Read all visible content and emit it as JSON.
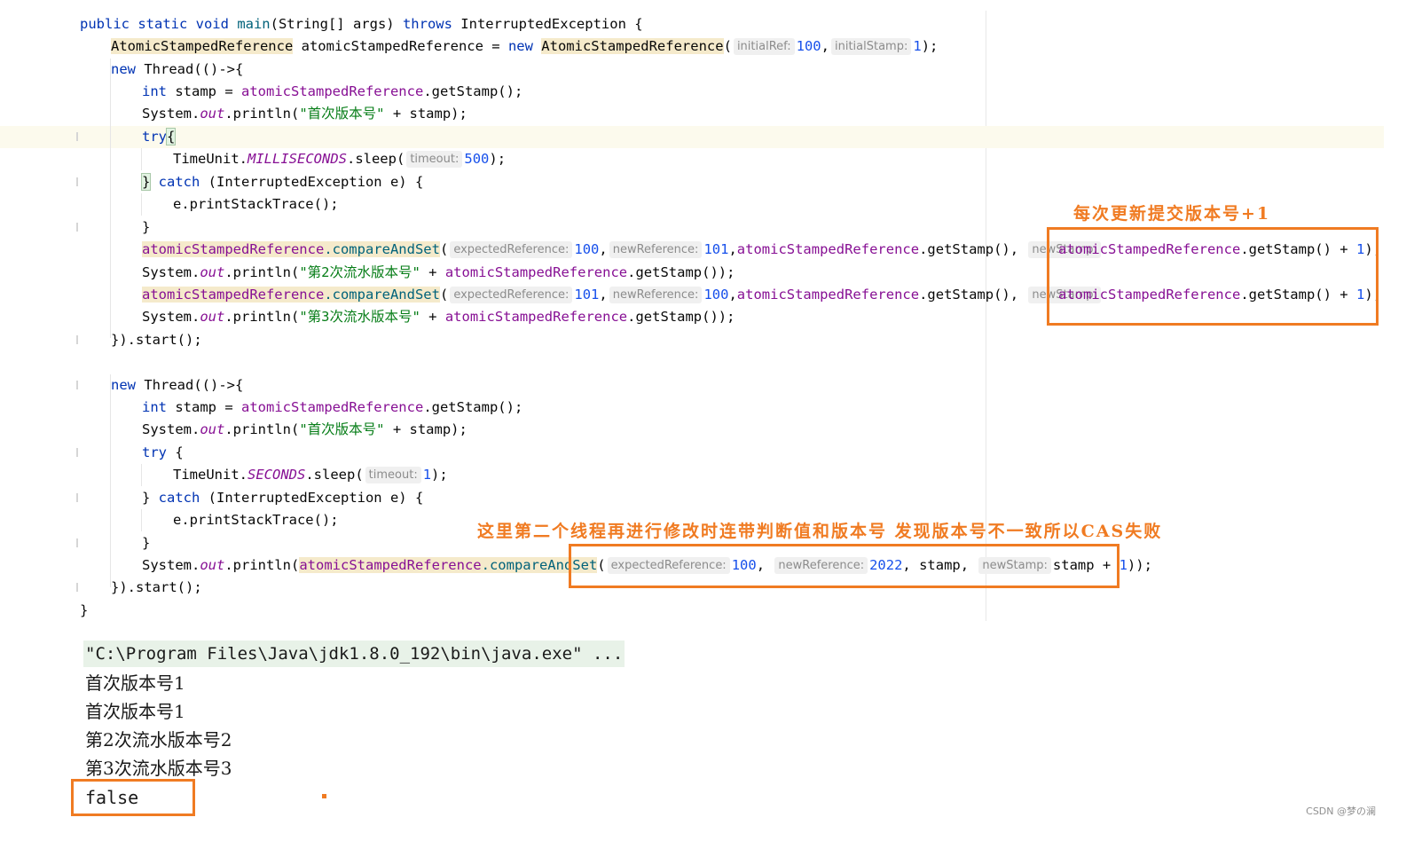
{
  "editor": {
    "lines": [
      {
        "t1": "public static void main(String[] args) throws InterruptedException {"
      },
      {
        "cls": "AtomicStampedReference",
        "var": " atomicStampedReference = ",
        "new": "new ",
        "ctor": "AtomicStampedReference",
        "open": "(",
        "hint1": "initialRef:",
        "v1": "100",
        "sep": ",",
        "hint2": "initialStamp:",
        "v2": "1",
        "close": ");"
      },
      {
        "kw": "new",
        "rest": " Thread(()->{"
      },
      {
        "kw": "int",
        "rest": " stamp = ",
        "fld": "atomicStampedReference",
        "tail": ".getStamp();"
      },
      {
        "a": "System.",
        "b": "out",
        "c": ".println(",
        "s": "\"首次版本号\"",
        "d": " + stamp);"
      },
      {
        "kw": "try",
        "rest": " {"
      },
      {
        "a": "TimeUnit.",
        "b": "MILLISECONDS",
        "c": ".sleep(",
        "hint": "timeout:",
        "v": "500",
        "d": ");"
      },
      {
        "b1": "}",
        "kw": " catch",
        "rest": " (InterruptedException e) {"
      },
      {
        "a": "e.printStackTrace();"
      },
      {
        "a": "}"
      },
      {
        "fld": "atomicStampedReference",
        "m": ".compareAndSet",
        "open": "(",
        "h1": "expectedReference:",
        "v1": "100",
        "sep1": ",",
        "h2": "newReference:",
        "v2": "101",
        "mid": ",",
        "fld2": "atomicStampedReference",
        "mid2": ".getStamp(), ",
        "h3": "newStamp:",
        "fld3": "atomicStampedReference",
        "tail": ".getStamp() + ",
        "v3": "1",
        "end": ");"
      },
      {
        "a": "System.",
        "b": "out",
        "c": ".println(",
        "s": "\"第2次流水版本号\"",
        "d": " + ",
        "fld": "atomicStampedReference",
        "e": ".getStamp());"
      },
      {
        "fld": "atomicStampedReference",
        "m": ".compareAndSet",
        "open": "(",
        "h1": "expectedReference:",
        "v1": "101",
        "sep1": ",",
        "h2": "newReference:",
        "v2": "100",
        "mid": ",",
        "fld2": "atomicStampedReference",
        "mid2": ".getStamp(), ",
        "h3": "newStamp:",
        "fld3": "atomicStampedReference",
        "tail": ".getStamp() + ",
        "v3": "1",
        "end": ");"
      },
      {
        "a": "System.",
        "b": "out",
        "c": ".println(",
        "s": "\"第3次流水版本号\"",
        "d": " + ",
        "fld": "atomicStampedReference",
        "e": ".getStamp());"
      },
      {
        "a": "}).start();"
      },
      {
        "kw": "new",
        "rest": " Thread(()->{"
      },
      {
        "kw": "int",
        "rest": " stamp = ",
        "fld": "atomicStampedReference",
        "tail": ".getStamp();"
      },
      {
        "a": "System.",
        "b": "out",
        "c": ".println(",
        "s": "\"首次版本号\"",
        "d": " + stamp);"
      },
      {
        "kw": "try",
        "rest": " {"
      },
      {
        "a": "TimeUnit.",
        "b": "SECONDS",
        "c": ".sleep(",
        "hint": "timeout:",
        "v": "1",
        "d": ");"
      },
      {
        "b1": "}",
        "kw": " catch",
        "rest": " (InterruptedException e) {"
      },
      {
        "a": "e.printStackTrace();"
      },
      {
        "a": "}"
      },
      {
        "a": "System.",
        "b": "out",
        "c": ".println(",
        "fld": "atomicStampedReference",
        "m": ".compareAndSet",
        "open": "(",
        "h1": "expectedReference:",
        "v1": "100",
        "sep1": ", ",
        "h2": "newReference:",
        "v2": "2022",
        "mid": ", stamp, ",
        "h3": "newStamp:",
        "tail": "stamp + ",
        "v3": "1",
        "end": "));"
      },
      {
        "a": "}).start();"
      },
      {
        "a": "}"
      }
    ]
  },
  "console": {
    "command": "\"C:\\Program Files\\Java\\jdk1.8.0_192\\bin\\java.exe\" ...",
    "output": [
      "首次版本号1",
      "首次版本号1",
      "第2次流水版本号2",
      "第3次流水版本号3",
      "false"
    ]
  },
  "annotations": {
    "stamp_note": "每次更新提交版本号+1",
    "cas_note": "这里第二个线程再进行修改时连带判断值和版本号 发现版本号不一致所以CAS失败"
  },
  "watermark": "CSDN @梦の澜",
  "colors": {
    "annotation": "#f07b22",
    "keyword": "#0033b3",
    "field": "#871094",
    "string": "#067d17",
    "number": "#1750eb"
  }
}
